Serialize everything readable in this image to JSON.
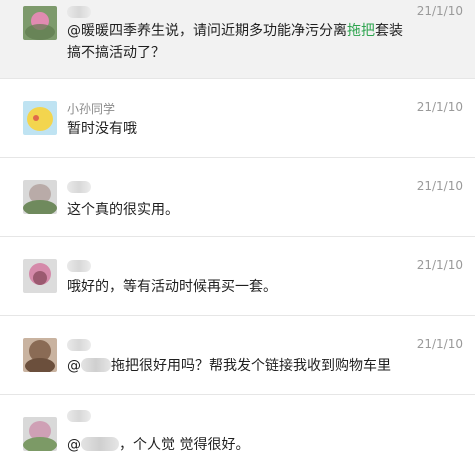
{
  "comments": [
    {
      "name": "",
      "time": "21/1/10",
      "text_prefix": "@暖暖四季养生说，请问近期多功能净污分离",
      "text_highlight": "拖把",
      "text_suffix": "套装搞不搞活动了？",
      "highlighted_row": true
    },
    {
      "name": "小孙同学",
      "time": "21/1/10",
      "text": "暂时没有哦"
    },
    {
      "name": "",
      "time": "21/1/10",
      "text": "这个真的很实用。"
    },
    {
      "name": "",
      "time": "21/1/10",
      "text": "哦好的，等有活动时候再买一套。"
    },
    {
      "name": "",
      "time": "21/1/10",
      "text_prefix": "@",
      "text_suffix": "拖把很好用吗？帮我发个链接我收到购物车里"
    },
    {
      "name": "",
      "time": "21/1/10",
      "text_prefix": "@",
      "text_suffix": "，个人觉 觉得很好。"
    }
  ],
  "colors": {
    "highlight_text": "#2ea44f",
    "row_highlight_bg": "#f2f2f2",
    "meta_text": "#9a9a9a"
  }
}
